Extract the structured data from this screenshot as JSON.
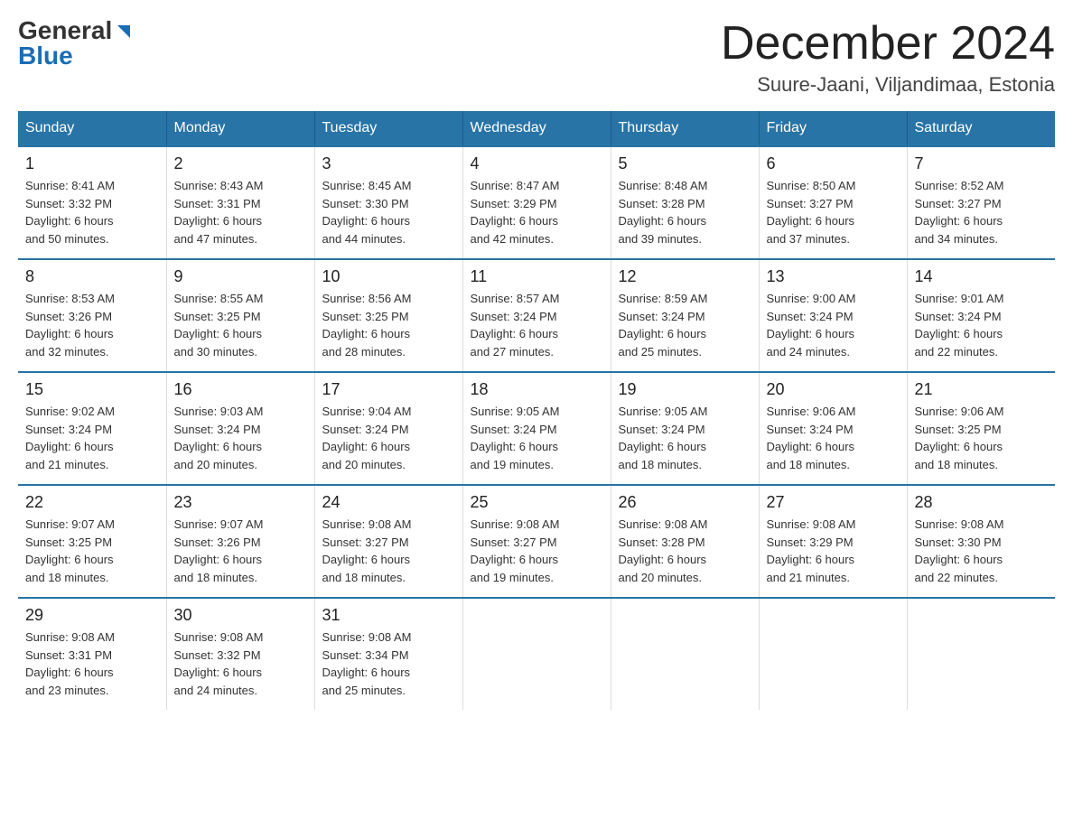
{
  "logo": {
    "general": "General",
    "blue": "Blue"
  },
  "header": {
    "month_title": "December 2024",
    "location": "Suure-Jaani, Viljandimaa, Estonia"
  },
  "weekdays": [
    "Sunday",
    "Monday",
    "Tuesday",
    "Wednesday",
    "Thursday",
    "Friday",
    "Saturday"
  ],
  "weeks": [
    [
      {
        "day": "1",
        "sunrise": "8:41 AM",
        "sunset": "3:32 PM",
        "daylight": "6 hours and 50 minutes."
      },
      {
        "day": "2",
        "sunrise": "8:43 AM",
        "sunset": "3:31 PM",
        "daylight": "6 hours and 47 minutes."
      },
      {
        "day": "3",
        "sunrise": "8:45 AM",
        "sunset": "3:30 PM",
        "daylight": "6 hours and 44 minutes."
      },
      {
        "day": "4",
        "sunrise": "8:47 AM",
        "sunset": "3:29 PM",
        "daylight": "6 hours and 42 minutes."
      },
      {
        "day": "5",
        "sunrise": "8:48 AM",
        "sunset": "3:28 PM",
        "daylight": "6 hours and 39 minutes."
      },
      {
        "day": "6",
        "sunrise": "8:50 AM",
        "sunset": "3:27 PM",
        "daylight": "6 hours and 37 minutes."
      },
      {
        "day": "7",
        "sunrise": "8:52 AM",
        "sunset": "3:27 PM",
        "daylight": "6 hours and 34 minutes."
      }
    ],
    [
      {
        "day": "8",
        "sunrise": "8:53 AM",
        "sunset": "3:26 PM",
        "daylight": "6 hours and 32 minutes."
      },
      {
        "day": "9",
        "sunrise": "8:55 AM",
        "sunset": "3:25 PM",
        "daylight": "6 hours and 30 minutes."
      },
      {
        "day": "10",
        "sunrise": "8:56 AM",
        "sunset": "3:25 PM",
        "daylight": "6 hours and 28 minutes."
      },
      {
        "day": "11",
        "sunrise": "8:57 AM",
        "sunset": "3:24 PM",
        "daylight": "6 hours and 27 minutes."
      },
      {
        "day": "12",
        "sunrise": "8:59 AM",
        "sunset": "3:24 PM",
        "daylight": "6 hours and 25 minutes."
      },
      {
        "day": "13",
        "sunrise": "9:00 AM",
        "sunset": "3:24 PM",
        "daylight": "6 hours and 24 minutes."
      },
      {
        "day": "14",
        "sunrise": "9:01 AM",
        "sunset": "3:24 PM",
        "daylight": "6 hours and 22 minutes."
      }
    ],
    [
      {
        "day": "15",
        "sunrise": "9:02 AM",
        "sunset": "3:24 PM",
        "daylight": "6 hours and 21 minutes."
      },
      {
        "day": "16",
        "sunrise": "9:03 AM",
        "sunset": "3:24 PM",
        "daylight": "6 hours and 20 minutes."
      },
      {
        "day": "17",
        "sunrise": "9:04 AM",
        "sunset": "3:24 PM",
        "daylight": "6 hours and 20 minutes."
      },
      {
        "day": "18",
        "sunrise": "9:05 AM",
        "sunset": "3:24 PM",
        "daylight": "6 hours and 19 minutes."
      },
      {
        "day": "19",
        "sunrise": "9:05 AM",
        "sunset": "3:24 PM",
        "daylight": "6 hours and 18 minutes."
      },
      {
        "day": "20",
        "sunrise": "9:06 AM",
        "sunset": "3:24 PM",
        "daylight": "6 hours and 18 minutes."
      },
      {
        "day": "21",
        "sunrise": "9:06 AM",
        "sunset": "3:25 PM",
        "daylight": "6 hours and 18 minutes."
      }
    ],
    [
      {
        "day": "22",
        "sunrise": "9:07 AM",
        "sunset": "3:25 PM",
        "daylight": "6 hours and 18 minutes."
      },
      {
        "day": "23",
        "sunrise": "9:07 AM",
        "sunset": "3:26 PM",
        "daylight": "6 hours and 18 minutes."
      },
      {
        "day": "24",
        "sunrise": "9:08 AM",
        "sunset": "3:27 PM",
        "daylight": "6 hours and 18 minutes."
      },
      {
        "day": "25",
        "sunrise": "9:08 AM",
        "sunset": "3:27 PM",
        "daylight": "6 hours and 19 minutes."
      },
      {
        "day": "26",
        "sunrise": "9:08 AM",
        "sunset": "3:28 PM",
        "daylight": "6 hours and 20 minutes."
      },
      {
        "day": "27",
        "sunrise": "9:08 AM",
        "sunset": "3:29 PM",
        "daylight": "6 hours and 21 minutes."
      },
      {
        "day": "28",
        "sunrise": "9:08 AM",
        "sunset": "3:30 PM",
        "daylight": "6 hours and 22 minutes."
      }
    ],
    [
      {
        "day": "29",
        "sunrise": "9:08 AM",
        "sunset": "3:31 PM",
        "daylight": "6 hours and 23 minutes."
      },
      {
        "day": "30",
        "sunrise": "9:08 AM",
        "sunset": "3:32 PM",
        "daylight": "6 hours and 24 minutes."
      },
      {
        "day": "31",
        "sunrise": "9:08 AM",
        "sunset": "3:34 PM",
        "daylight": "6 hours and 25 minutes."
      },
      null,
      null,
      null,
      null
    ]
  ]
}
